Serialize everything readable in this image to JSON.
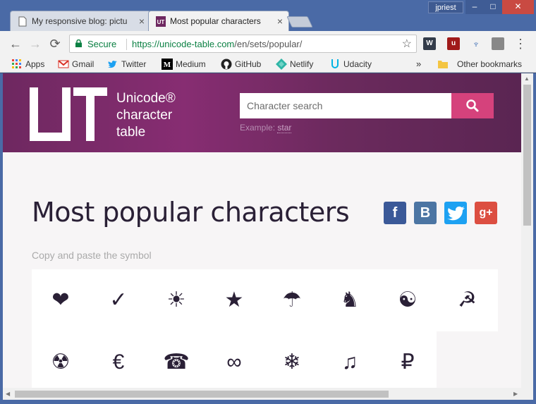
{
  "window": {
    "user": "jpriest",
    "minimize": "–",
    "maximize": "□",
    "close": "✕"
  },
  "tabs": [
    {
      "title": "My responsive blog: pictu",
      "close": "×"
    },
    {
      "title": "Most popular characters",
      "close": "×"
    }
  ],
  "toolbar": {
    "back": "←",
    "forward": "→",
    "reload": "⟳",
    "secure_label": "Secure",
    "url_host": "https://unicode-table.com",
    "url_path": "/en/sets/popular/",
    "star": "☆",
    "menu": "⋮"
  },
  "bookmarks": {
    "items": [
      {
        "label": "Apps",
        "icon": "apps-icon"
      },
      {
        "label": "Gmail",
        "icon": "gmail-icon"
      },
      {
        "label": "Twitter",
        "icon": "twitter-icon"
      },
      {
        "label": "Medium",
        "icon": "medium-icon"
      },
      {
        "label": "GitHub",
        "icon": "github-icon"
      },
      {
        "label": "Netlify",
        "icon": "netlify-icon"
      },
      {
        "label": "Udacity",
        "icon": "udacity-icon"
      }
    ],
    "overflow": "»",
    "other": "Other bookmarks"
  },
  "site": {
    "brand_line1": "Unicode®",
    "brand_line2": "character",
    "brand_line3": "table",
    "search_placeholder": "Character search",
    "example_label": "Example:",
    "example_link": "star",
    "page_title": "Most popular characters",
    "subtitle": "Copy and paste the symbol",
    "social": [
      {
        "name": "facebook",
        "glyph": "f",
        "color": "#3b5998"
      },
      {
        "name": "vk",
        "glyph": "B",
        "color": "#4c75a3"
      },
      {
        "name": "twitter",
        "glyph": "t",
        "color": "#1da1f2"
      },
      {
        "name": "google-plus",
        "glyph": "g+",
        "color": "#dc4e41"
      }
    ],
    "symbols_row1": [
      "❤",
      "✓",
      "☀",
      "★",
      "☂",
      "♞",
      "☯",
      "☭"
    ],
    "symbols_row2": [
      "☢",
      "€",
      "☎",
      "∞",
      "❄",
      "♫",
      "₽"
    ]
  }
}
